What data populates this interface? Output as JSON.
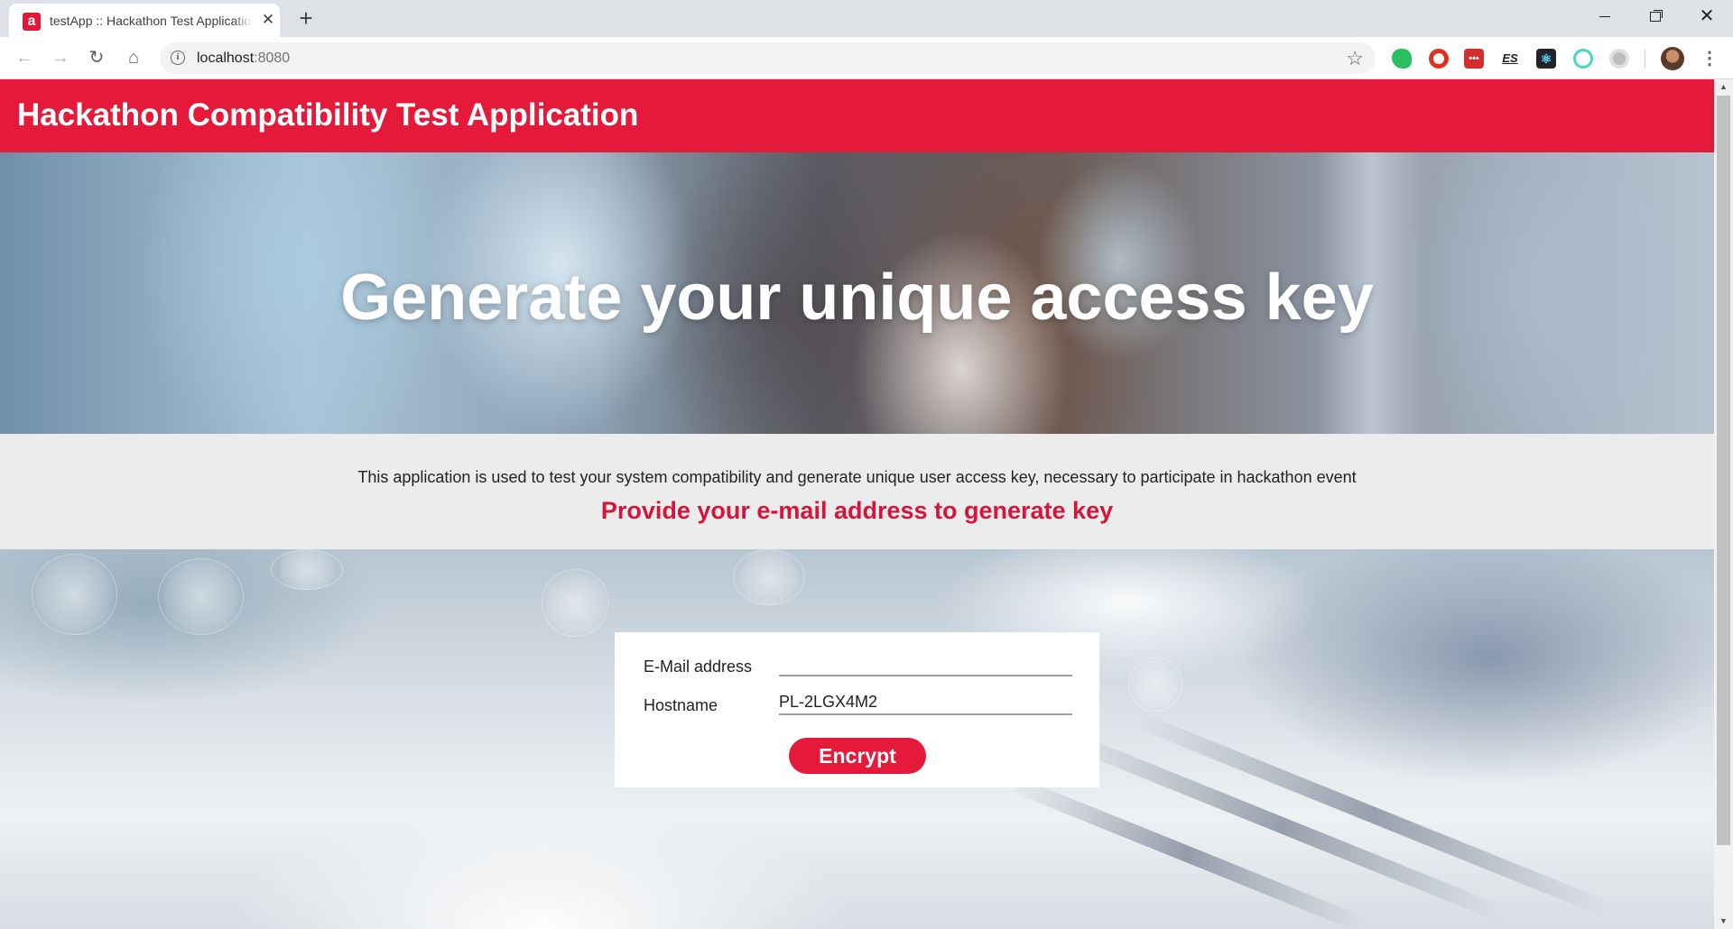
{
  "browser": {
    "tab": {
      "title": "testApp :: Hackathon Test Application",
      "favicon_letter": "a",
      "close_glyph": "✕"
    },
    "new_tab_glyph": "+",
    "window_controls": {
      "close_glyph": "✕"
    },
    "nav": {
      "back_glyph": "←",
      "forward_glyph": "→",
      "reload_glyph": "↻",
      "home_glyph": "⌂"
    },
    "address": {
      "host": "localhost",
      "port": ":8080",
      "info_glyph": "i",
      "star_glyph": "☆"
    },
    "extensions": [
      {
        "icon": "evernote-icon",
        "glyph": ""
      },
      {
        "icon": "opera-vpn-icon",
        "glyph": ""
      },
      {
        "icon": "lastpass-icon",
        "glyph": "•••"
      },
      {
        "icon": "es-icon",
        "glyph": "ES"
      },
      {
        "icon": "react-devtools-icon",
        "glyph": "⚛"
      },
      {
        "icon": "color-picker-icon",
        "glyph": ""
      },
      {
        "icon": "gray-extension-icon",
        "glyph": ""
      }
    ],
    "menu_glyph": "⋮"
  },
  "app": {
    "header_title": "Hackathon Compatibility Test Application",
    "hero_title": "Generate your unique access key",
    "info_text": "This application is used to test your system compatibility and generate unique user access key, necessary to participate in hackathon event",
    "cta_text": "Provide your e-mail address to generate key",
    "form": {
      "email_label": "E-Mail address",
      "email_value": "",
      "hostname_label": "Hostname",
      "hostname_value": "PL-2LGX4M2",
      "submit_label": "Encrypt"
    }
  },
  "colors": {
    "brand_red": "#e5193a",
    "cta_red": "#d7143a",
    "info_band": "#ececec"
  }
}
